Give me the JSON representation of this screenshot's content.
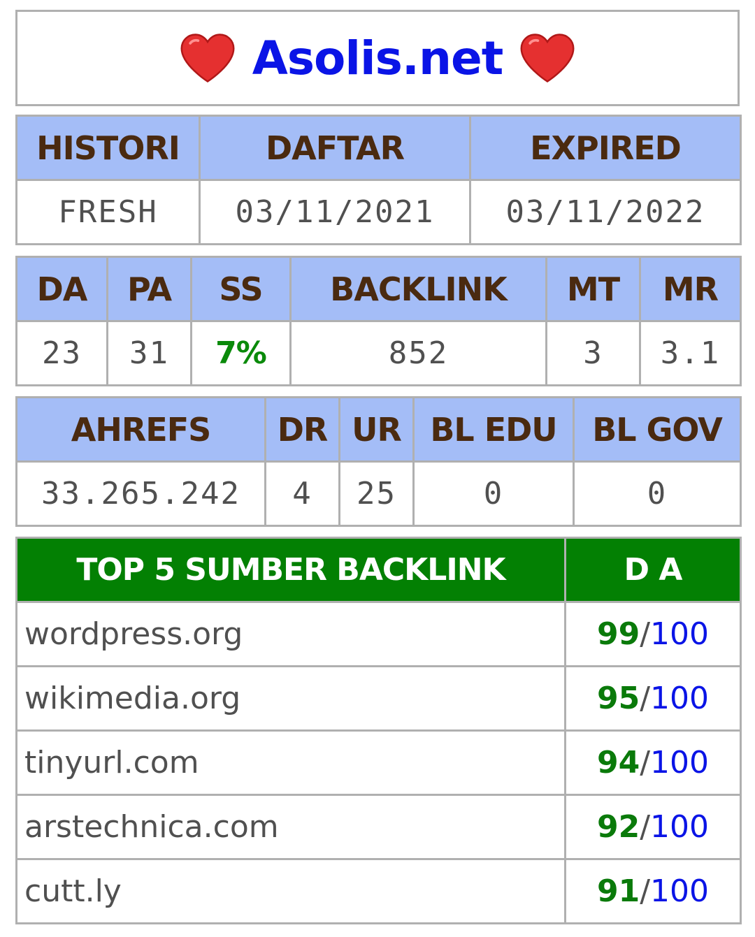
{
  "header": {
    "title": "Asolis.net",
    "icon": "heart-icon",
    "icon_color": "#e53030"
  },
  "history_table": {
    "headers": [
      "HISTORI",
      "DAFTAR",
      "EXPIRED"
    ],
    "values": [
      "FRESH",
      "03/11/2021",
      "03/11/2022"
    ]
  },
  "moz_table": {
    "headers": [
      "DA",
      "PA",
      "SS",
      "BACKLINK",
      "MT",
      "MR"
    ],
    "values": [
      "23",
      "31",
      "7%",
      "852",
      "3",
      "3.1"
    ]
  },
  "ahrefs_table": {
    "headers": [
      "AHREFS",
      "DR",
      "UR",
      "BL EDU",
      "BL GOV"
    ],
    "values": [
      "33.265.242",
      "4",
      "25",
      "0",
      "0"
    ]
  },
  "backlinks_table": {
    "headers": [
      "TOP 5 SUMBER BACKLINK",
      "D A"
    ],
    "rows": [
      {
        "site": "wordpress.org",
        "score": "99",
        "sep": "/",
        "max": "100"
      },
      {
        "site": "wikimedia.org",
        "score": "95",
        "sep": "/",
        "max": "100"
      },
      {
        "site": "tinyurl.com",
        "score": "94",
        "sep": "/",
        "max": "100"
      },
      {
        "site": "arstechnica.com",
        "score": "92",
        "sep": "/",
        "max": "100"
      },
      {
        "site": "cutt.ly",
        "score": "91",
        "sep": "/",
        "max": "100"
      }
    ]
  },
  "colors": {
    "header_bg": "#a4bdf7",
    "header_text": "#4a2a10",
    "green_header_bg": "#038003",
    "title_blue": "#0a14e6",
    "score_green": "#0a7a0a"
  }
}
